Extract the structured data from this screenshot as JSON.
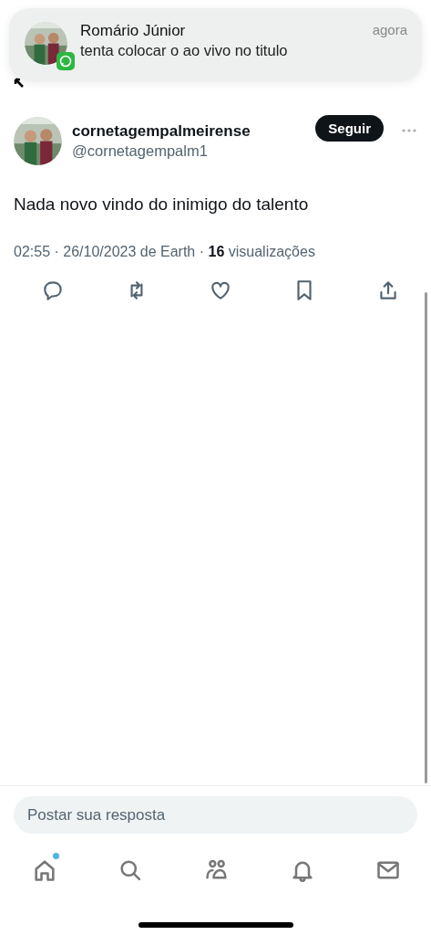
{
  "notification": {
    "sender": "Romário Júnior",
    "message": "tenta colocar o ao vivo no titulo",
    "time": "agora"
  },
  "post": {
    "display_name": "cornetagempalmeirense",
    "handle": "@cornetagempalm1",
    "follow_button": "Seguir",
    "text": "Nada novo vindo do inimigo do talento",
    "meta": "02:55 · 26/10/2023 de Earth · **16** visualizações"
  },
  "actions": [
    {
      "kind": "reply"
    },
    {
      "kind": "repost"
    },
    {
      "kind": "like"
    },
    {
      "kind": "bookmark"
    },
    {
      "kind": "share"
    }
  ],
  "reply_field": {
    "placeholder": "Postar sua resposta"
  },
  "nav": [
    {
      "kind": "home",
      "badge": true
    },
    {
      "kind": "search",
      "badge": false
    },
    {
      "kind": "communities",
      "badge": false
    },
    {
      "kind": "notifications",
      "badge": false
    },
    {
      "kind": "messages",
      "badge": false
    }
  ]
}
